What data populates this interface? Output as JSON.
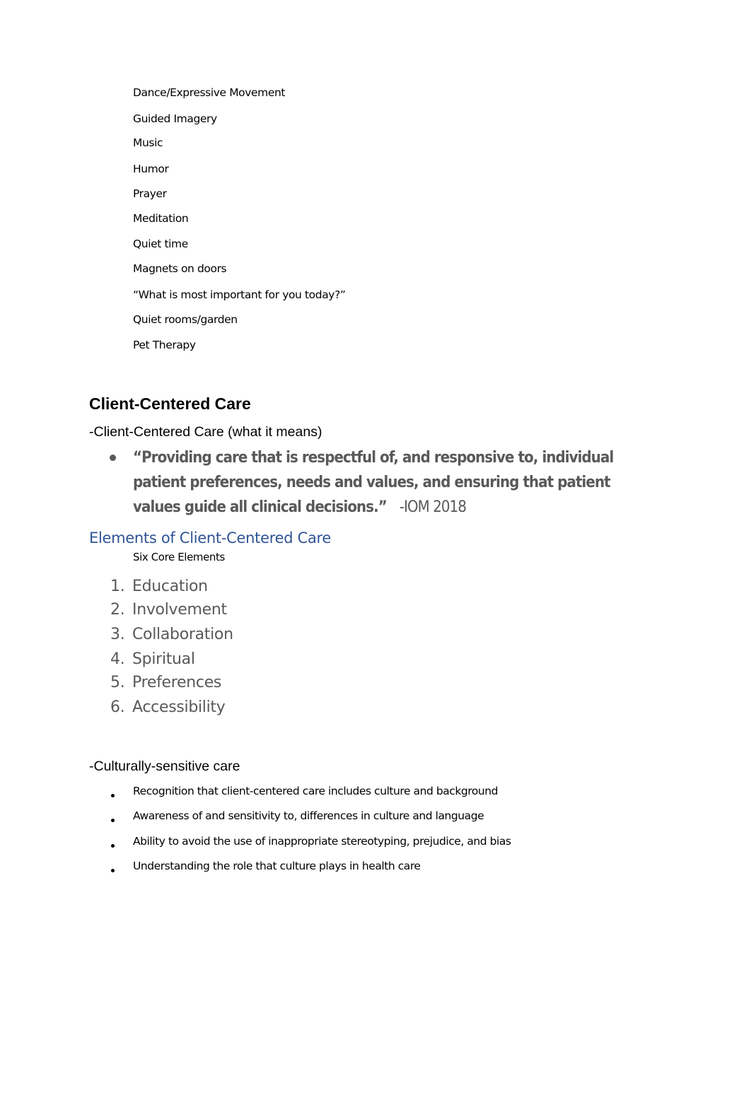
{
  "therapies": [
    "Dance/Expressive Movement",
    "Guided Imagery",
    "Music",
    "Humor",
    "Prayer",
    "Meditation",
    "Quiet time",
    "Magnets on doors",
    "“What is most important for you today?”",
    "Quiet rooms/garden",
    "Pet Therapy"
  ],
  "client_centered": {
    "heading": "Client-Centered Care",
    "subheading": "-Client-Centered Care (what it means)",
    "quote": "“Providing care that is respectful of, and responsive to, individual patient preferences, needs and values, and ensuring that patient values guide all clinical decisions.”",
    "quote_source": "-IOM 2018"
  },
  "elements": {
    "heading": "Elements of Client-Centered Care",
    "subheading": "Six Core Elements",
    "items": [
      {
        "num": "1.",
        "label": "Education"
      },
      {
        "num": "2.",
        "label": "Involvement"
      },
      {
        "num": "3.",
        "label": "Collaboration"
      },
      {
        "num": "4.",
        "label": "Spiritual"
      },
      {
        "num": "5.",
        "label": "Preferences"
      },
      {
        "num": "6.",
        "label": "Accessibility"
      }
    ]
  },
  "cultural": {
    "heading": "-Culturally-sensitive care",
    "items": [
      "Recognition that client-centered care includes culture and background",
      "Awareness of and sensitivity to, differences in culture and language",
      "Ability to avoid the use of inappropriate stereotyping, prejudice, and bias",
      "Understanding the role that culture plays in health care"
    ]
  },
  "colors": {
    "heading_blue": "#2f5496",
    "quote_gray": "#595959",
    "text_black": "#000000"
  }
}
